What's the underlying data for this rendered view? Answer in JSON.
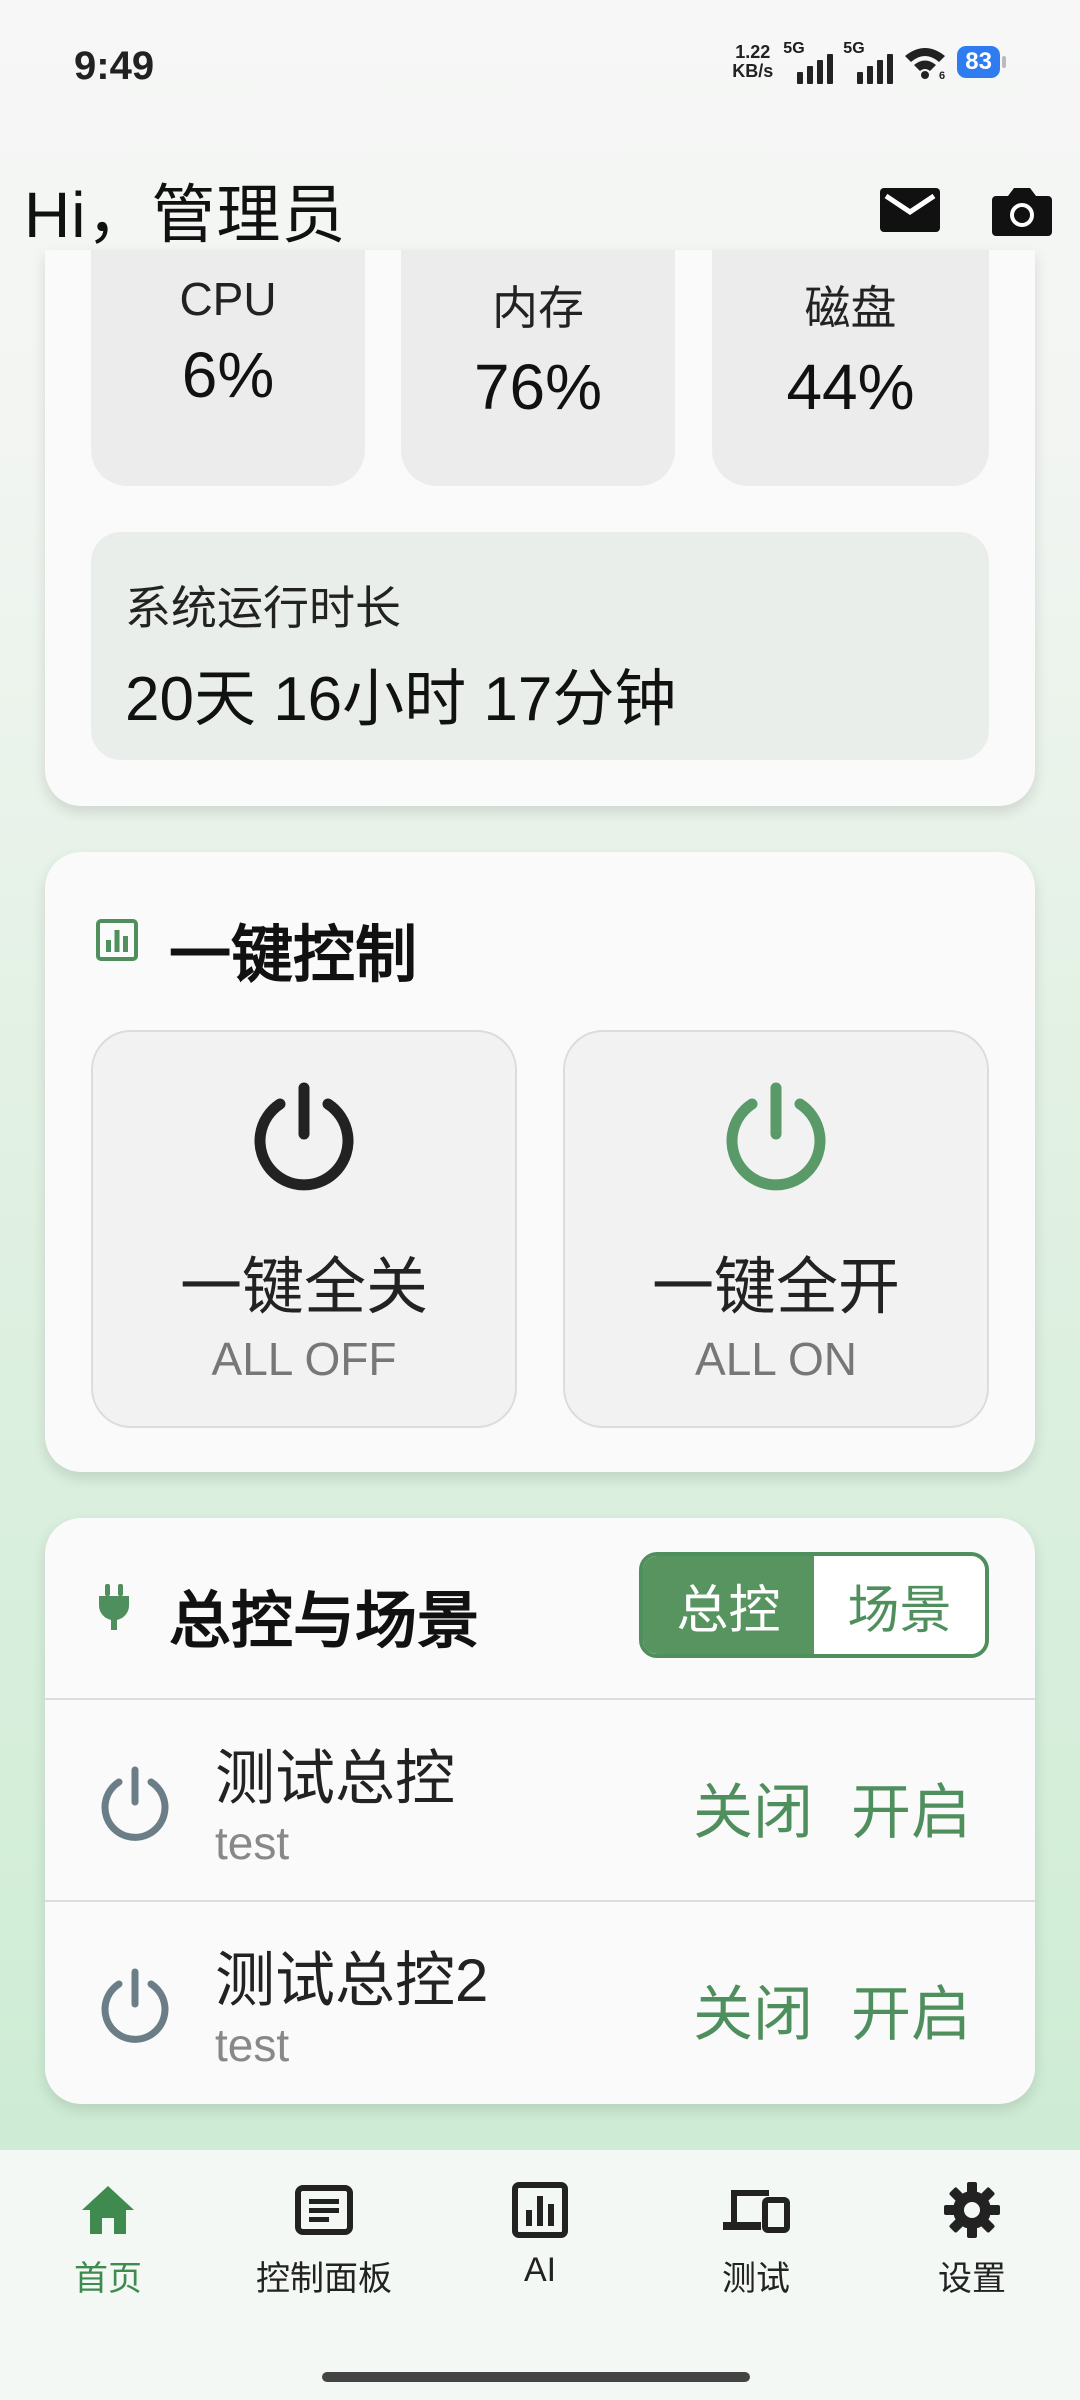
{
  "status_bar": {
    "time": "9:49",
    "speed": "1.22",
    "speed_unit": "KB/s",
    "net1": "5G",
    "net2": "5G",
    "wifi_sub": "6",
    "battery": "83"
  },
  "header": {
    "greeting": "Hi，管理员",
    "icons": [
      "mail-icon",
      "camera-icon"
    ]
  },
  "system": {
    "cpu": {
      "label": "CPU",
      "value": "6%"
    },
    "memory": {
      "label": "内存",
      "value": "76%"
    },
    "disk": {
      "label": "磁盘",
      "value": "44%"
    },
    "uptime_label": "系统运行时长",
    "uptime_value": "20天 16小时 17分钟"
  },
  "quick_control": {
    "title": "一键控制",
    "off": {
      "label": "一键全关",
      "sub": "ALL OFF"
    },
    "on": {
      "label": "一键全开",
      "sub": "ALL ON"
    },
    "colors": {
      "off": "#222222",
      "on": "#5a9a68"
    }
  },
  "master": {
    "title": "总控与场景",
    "tabs": [
      "总控",
      "场景"
    ],
    "selected_tab": "总控",
    "items": [
      {
        "name": "测试总控",
        "desc": "test",
        "close": "关闭",
        "open": "开启"
      },
      {
        "name": "测试总控2",
        "desc": "test",
        "close": "关闭",
        "open": "开启"
      }
    ]
  },
  "nav": {
    "items": [
      {
        "label": "首页",
        "icon": "home-icon",
        "active": true
      },
      {
        "label": "控制面板",
        "icon": "panel-icon",
        "active": false
      },
      {
        "label": "AI",
        "icon": "chart-icon",
        "active": false
      },
      {
        "label": "测试",
        "icon": "devices-icon",
        "active": false
      },
      {
        "label": "设置",
        "icon": "gear-icon",
        "active": false
      }
    ]
  },
  "theme": {
    "accent": "#4f8f5d",
    "accent_fill": "#57945f"
  }
}
